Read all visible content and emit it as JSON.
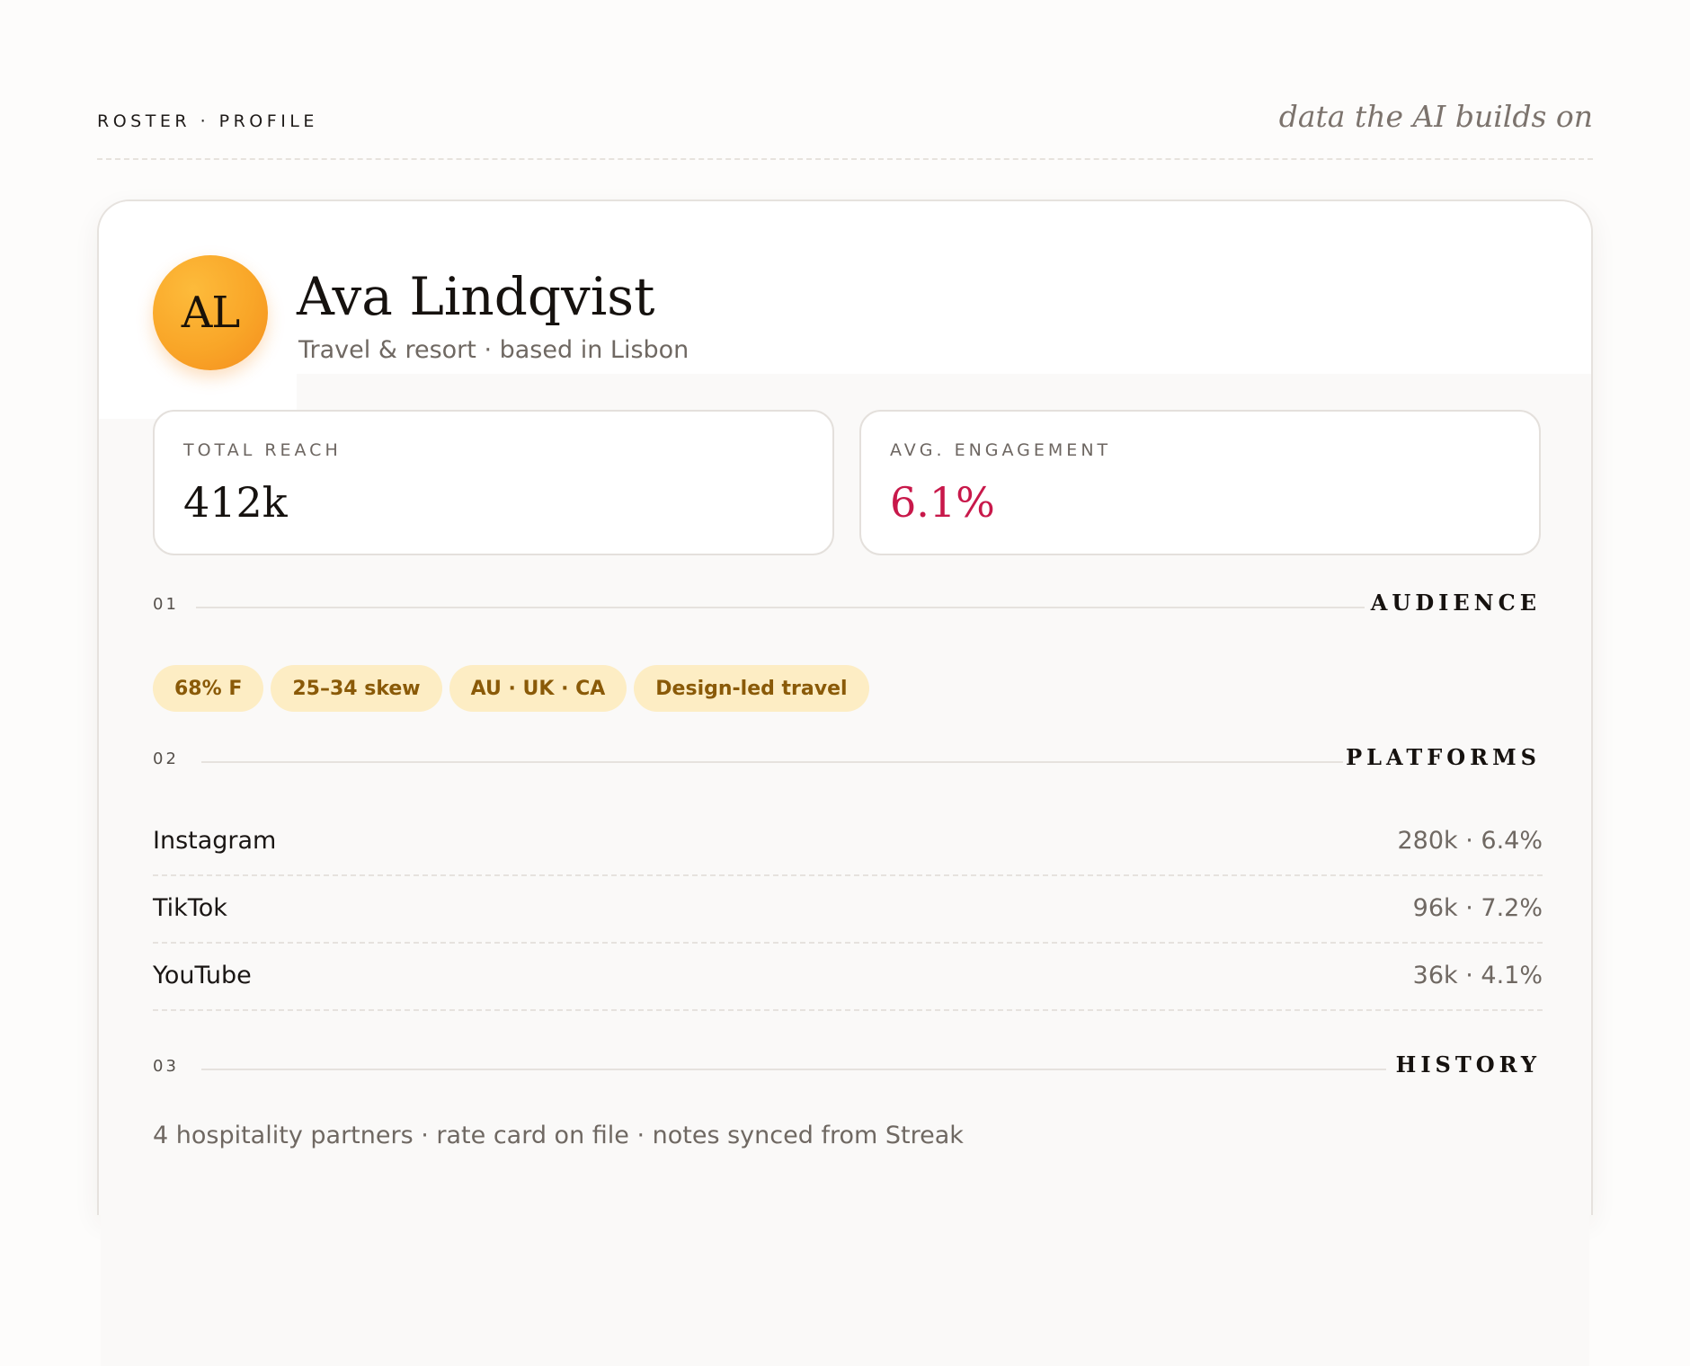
{
  "header": {
    "breadcrumb": "ROSTER · PROFILE",
    "tagline": "data the AI builds on"
  },
  "profile": {
    "initials": "AL",
    "name": "Ava Lindqvist",
    "subtitle": "Travel & resort · based in Lisbon"
  },
  "stats": [
    {
      "label": "TOTAL REACH",
      "value": "412k"
    },
    {
      "label": "AVG. ENGAGEMENT",
      "value": "6.1%"
    }
  ],
  "sections": [
    {
      "number": "01",
      "title": "AUDIENCE"
    },
    {
      "number": "02",
      "title": "PLATFORMS"
    },
    {
      "number": "03",
      "title": "HISTORY"
    }
  ],
  "audience_tags": [
    "68% F",
    "25–34 skew",
    "AU · UK · CA",
    "Design-led travel"
  ],
  "platforms": [
    {
      "name": "Instagram",
      "stats": "280k · 6.4%"
    },
    {
      "name": "TikTok",
      "stats": "96k · 7.2%"
    },
    {
      "name": "YouTube",
      "stats": "36k · 4.1%"
    }
  ],
  "history": "4 hospitality partners · rate card on file · notes synced from Streak",
  "colors": {
    "accent": "#c8184a",
    "avatar": "#f9a628",
    "tag_bg": "#fdedc4",
    "tag_text": "#8a5a08"
  }
}
